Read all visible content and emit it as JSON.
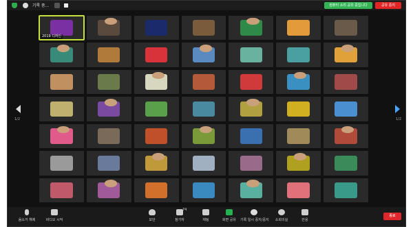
{
  "topbar": {
    "title": "기록 중...",
    "status_label": "컴퓨터 소리 공유 중입니다",
    "record_label": "공유 중지"
  },
  "toolbar": {
    "mute_label": "음소거 해제",
    "video_label": "비디오 시작",
    "security_label": "보안",
    "participants_label": "참가자",
    "participants_count": "74",
    "chat_label": "채팅",
    "share_label": "화면 공유",
    "record_label": "기록 일시 중지/중지",
    "reactions_label": "소회의실",
    "apps_label": "반응",
    "end_label": "종료"
  },
  "page": {
    "left": "1/2",
    "right": "1/2"
  },
  "grid": {
    "active_label": "2019 디자인",
    "tile_colors": [
      "#7a2fa3",
      "#5a4a3e",
      "#1a2a6a",
      "#7a5c3c",
      "#2f8a4a",
      "#e39a3a",
      "#6a5a4a",
      "#3a8a7a",
      "#b07a3a",
      "#d8323a",
      "#5a8abf",
      "#6ab2a0",
      "#4aa0a0",
      "#e0a03a",
      "#c09060",
      "#6a7a4a",
      "#d7d7c0",
      "#b45a3a",
      "#d03a3a",
      "#3a90c0",
      "#a04a4a",
      "#bfb070",
      "#7a4aa0",
      "#5aa04a",
      "#4a8aa0",
      "#b0a040",
      "#d0b020",
      "#4a90d0",
      "#e05a8a",
      "#7a6a5a",
      "#c0502a",
      "#7a9a3a",
      "#3a70b0",
      "#a08a5a",
      "#b04a3a",
      "#9a9a9a",
      "#6a7a9a",
      "#c09a3a",
      "#a0b0c0",
      "#9a6a8a",
      "#b0a020",
      "#3a8a5a",
      "#c05a6a",
      "#a05a9a",
      "#d0702a",
      "#3a8ac0",
      "#5ab0a0",
      "#e0707a",
      "#3a9a8a"
    ]
  }
}
